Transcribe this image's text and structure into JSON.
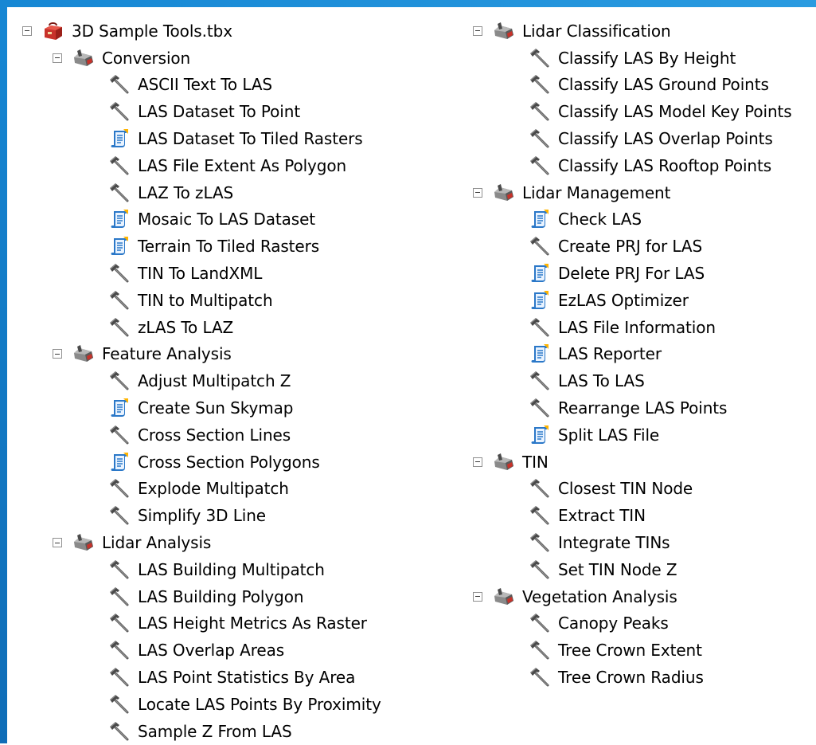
{
  "left_column": [
    {
      "level": 0,
      "type": "toolbox",
      "label": "3D Sample Tools.tbx"
    },
    {
      "level": 1,
      "type": "toolset",
      "label": "Conversion"
    },
    {
      "level": 2,
      "type": "tool",
      "label": "ASCII Text To LAS"
    },
    {
      "level": 2,
      "type": "tool",
      "label": "LAS Dataset To Point"
    },
    {
      "level": 2,
      "type": "script",
      "label": "LAS Dataset To Tiled Rasters"
    },
    {
      "level": 2,
      "type": "tool",
      "label": "LAS File Extent As Polygon"
    },
    {
      "level": 2,
      "type": "tool",
      "label": "LAZ To zLAS"
    },
    {
      "level": 2,
      "type": "script",
      "label": "Mosaic To LAS Dataset"
    },
    {
      "level": 2,
      "type": "script",
      "label": "Terrain To Tiled Rasters"
    },
    {
      "level": 2,
      "type": "tool",
      "label": "TIN To LandXML"
    },
    {
      "level": 2,
      "type": "tool",
      "label": "TIN to Multipatch"
    },
    {
      "level": 2,
      "type": "tool",
      "label": "zLAS To LAZ"
    },
    {
      "level": 1,
      "type": "toolset",
      "label": "Feature Analysis"
    },
    {
      "level": 2,
      "type": "tool",
      "label": "Adjust Multipatch Z"
    },
    {
      "level": 2,
      "type": "script",
      "label": "Create Sun Skymap"
    },
    {
      "level": 2,
      "type": "tool",
      "label": "Cross Section Lines"
    },
    {
      "level": 2,
      "type": "script",
      "label": "Cross Section Polygons"
    },
    {
      "level": 2,
      "type": "tool",
      "label": "Explode Multipatch"
    },
    {
      "level": 2,
      "type": "tool",
      "label": "Simplify 3D Line"
    },
    {
      "level": 1,
      "type": "toolset",
      "label": "Lidar Analysis"
    },
    {
      "level": 2,
      "type": "tool",
      "label": "LAS Building Multipatch"
    },
    {
      "level": 2,
      "type": "tool",
      "label": "LAS Building Polygon"
    },
    {
      "level": 2,
      "type": "tool",
      "label": "LAS Height Metrics As Raster"
    },
    {
      "level": 2,
      "type": "tool",
      "label": "LAS Overlap Areas"
    },
    {
      "level": 2,
      "type": "tool",
      "label": "LAS Point Statistics By Area"
    },
    {
      "level": 2,
      "type": "tool",
      "label": "Locate LAS Points By Proximity"
    },
    {
      "level": 2,
      "type": "tool",
      "label": "Sample Z From LAS"
    }
  ],
  "right_column": [
    {
      "level": 1,
      "type": "toolset",
      "label": "Lidar Classification"
    },
    {
      "level": 2,
      "type": "tool",
      "label": "Classify LAS By Height"
    },
    {
      "level": 2,
      "type": "tool",
      "label": "Classify LAS Ground Points"
    },
    {
      "level": 2,
      "type": "tool",
      "label": "Classify LAS Model Key Points"
    },
    {
      "level": 2,
      "type": "tool",
      "label": "Classify LAS Overlap Points"
    },
    {
      "level": 2,
      "type": "tool",
      "label": "Classify LAS Rooftop Points"
    },
    {
      "level": 1,
      "type": "toolset",
      "label": "Lidar Management"
    },
    {
      "level": 2,
      "type": "script",
      "label": "Check LAS"
    },
    {
      "level": 2,
      "type": "tool",
      "label": "Create PRJ for LAS"
    },
    {
      "level": 2,
      "type": "script",
      "label": "Delete PRJ For LAS"
    },
    {
      "level": 2,
      "type": "script",
      "label": "EzLAS Optimizer"
    },
    {
      "level": 2,
      "type": "tool",
      "label": "LAS File Information"
    },
    {
      "level": 2,
      "type": "script",
      "label": "LAS Reporter"
    },
    {
      "level": 2,
      "type": "tool",
      "label": "LAS To LAS"
    },
    {
      "level": 2,
      "type": "tool",
      "label": "Rearrange LAS Points"
    },
    {
      "level": 2,
      "type": "script",
      "label": "Split LAS File"
    },
    {
      "level": 1,
      "type": "toolset",
      "label": "TIN"
    },
    {
      "level": 2,
      "type": "tool",
      "label": "Closest TIN Node"
    },
    {
      "level": 2,
      "type": "tool",
      "label": "Extract TIN"
    },
    {
      "level": 2,
      "type": "tool",
      "label": "Integrate TINs"
    },
    {
      "level": 2,
      "type": "tool",
      "label": "Set TIN Node Z"
    },
    {
      "level": 1,
      "type": "toolset",
      "label": "Vegetation Analysis"
    },
    {
      "level": 2,
      "type": "tool",
      "label": "Canopy Peaks"
    },
    {
      "level": 2,
      "type": "tool",
      "label": "Tree Crown Extent"
    },
    {
      "level": 2,
      "type": "tool",
      "label": "Tree Crown Radius"
    }
  ],
  "colors": {
    "frame": "#1687d4",
    "background": "#ffffff",
    "text": "#000000",
    "toolbox_red": "#c8322a",
    "toolset_gray": "#6e6e6e",
    "script_blue": "#2b78c8"
  },
  "icons": {
    "toolbox": "toolbox-icon",
    "toolset": "toolset-icon",
    "tool": "hammer-icon",
    "script": "script-icon"
  }
}
